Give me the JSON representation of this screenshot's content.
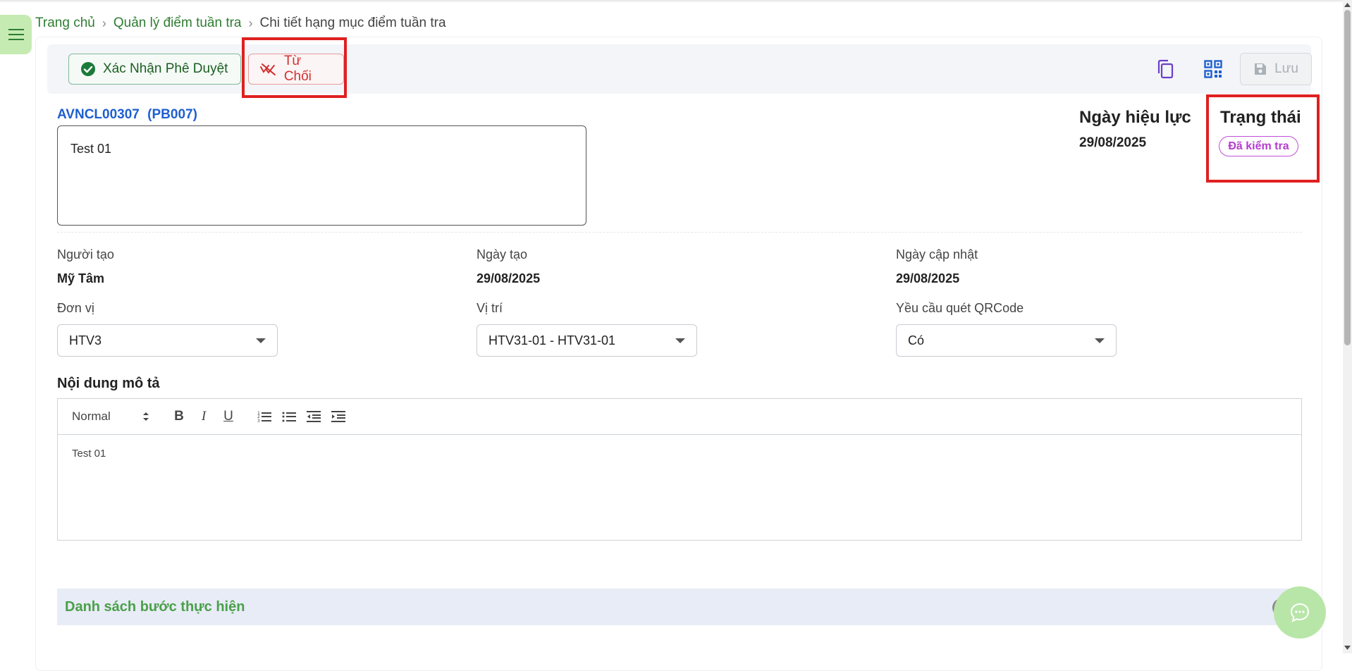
{
  "breadcrumb": {
    "home": "Trang chủ",
    "parent": "Quản lý điểm tuần tra",
    "current": "Chi tiết hạng mục điểm tuần tra"
  },
  "toolbar": {
    "approve_label": "Xác Nhận Phê Duyệt",
    "reject_label": "Từ Chối",
    "save_label": "Lưu"
  },
  "record": {
    "code": "AVNCL00307",
    "sub_code": "(PB007)",
    "name_value": "Test 01"
  },
  "effective_date": {
    "label": "Ngày hiệu lực",
    "value": "29/08/2025"
  },
  "status": {
    "label": "Trạng thái",
    "value": "Đã kiểm tra",
    "color": "#b53ccf"
  },
  "meta": {
    "creator_label": "Người tạo",
    "creator_value": "Mỹ Tâm",
    "created_label": "Ngày tạo",
    "created_value": "29/08/2025",
    "updated_label": "Ngày cập nhật",
    "updated_value": "29/08/2025"
  },
  "fields": {
    "unit_label": "Đơn vị",
    "unit_value": "HTV3",
    "location_label": "Vị trí",
    "location_value": "HTV31-01 - HTV31-01",
    "qr_label": "Yều cầu quét QRCode",
    "qr_value": "Có"
  },
  "description": {
    "title": "Nội dung mô tả",
    "format_value": "Normal",
    "content": "Test 01"
  },
  "steps": {
    "title": "Danh sách bước thực hiện"
  },
  "colors": {
    "accent_green": "#2e7d32",
    "reject_red": "#d32f2f",
    "highlight_red": "#e02020",
    "link_blue": "#1e5fd0"
  },
  "icons": [
    "menu-icon",
    "check-circle-icon",
    "reject-icon",
    "copy-icon",
    "qr-code-icon",
    "save-icon",
    "chat-icon"
  ]
}
